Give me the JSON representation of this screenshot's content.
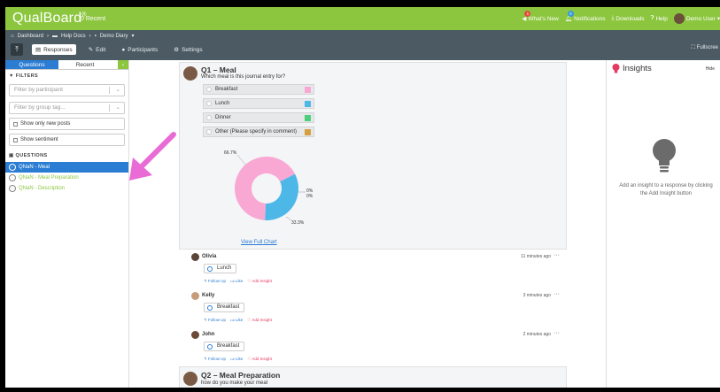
{
  "topbar": {
    "logo": "QualBoard",
    "logo_mark": "®",
    "recent": "Recent",
    "whats_new": "What's New",
    "whats_new_badge": "1",
    "notifications": "Notifications",
    "notifications_badge": "0",
    "downloads": "Downloads",
    "help": "Help",
    "user": "Demo User"
  },
  "breadcrumb": {
    "items": [
      "Dashboard",
      "Help Docs",
      "Demo Diary"
    ]
  },
  "toolbar": {
    "responses": "Responses",
    "edit": "Edit",
    "participants": "Participants",
    "settings": "Settings",
    "fullscreen": "Fullscree"
  },
  "sidebar": {
    "tab_questions": "Questions",
    "tab_recent": "Recent",
    "filters_heading": "FILTERS",
    "filter_participant_placeholder": "Filter by participant",
    "filter_group_placeholder": "Filter by group tag...",
    "show_new": "Show only new posts",
    "show_sentiment": "Show sentiment",
    "questions_heading": "QUESTIONS",
    "questions": [
      {
        "label": "QNaN - Meal",
        "active": true
      },
      {
        "label": "QNaN - Meal Preparation",
        "active": false
      },
      {
        "label": "QNaN - Description",
        "active": false
      }
    ]
  },
  "q1": {
    "title": "Q1 – Meal",
    "subtitle": "Which meal is this journal entry for?",
    "options": [
      {
        "label": "Breakfast",
        "color": "#f9a8d4"
      },
      {
        "label": "Lunch",
        "color": "#4db8e8"
      },
      {
        "label": "Dinner",
        "color": "#4ccf7a"
      },
      {
        "label": "Other (Please specify in comment)",
        "color": "#d4a040"
      }
    ],
    "view_full_chart": "View Full Chart"
  },
  "chart_data": {
    "type": "pie",
    "categories": [
      "Breakfast",
      "Lunch",
      "Dinner",
      "Other (Please specify in comment)"
    ],
    "values": [
      66.7,
      33.3,
      0,
      0
    ],
    "labels": [
      "66.7%",
      "33.3%",
      "0%",
      "0%"
    ],
    "colors": [
      "#f9a8d4",
      "#4db8e8",
      "#4ccf7a",
      "#d4a040"
    ],
    "donut": true
  },
  "responses": [
    {
      "name": "Olivia",
      "time": "11 minutes ago",
      "answer": "Lunch",
      "avatar_color": "#5a4638"
    },
    {
      "name": "Kelly",
      "time": "3 minutes ago",
      "answer": "Breakfast",
      "avatar_color": "#c99a7c"
    },
    {
      "name": "John",
      "time": "2 minutes ago",
      "answer": "Breakfast",
      "avatar_color": "#6c4a38"
    }
  ],
  "actions": {
    "follow_up": "Follow Up",
    "like": "Like",
    "add_insight": "Add Insight",
    "menu": "···"
  },
  "q2": {
    "title": "Q2 – Meal Preparation",
    "subtitle": "how do you make your meal"
  },
  "insights": {
    "title": "Insights",
    "hide": "Hide",
    "message": "Add an insight to a response by clicking the Add Insight button"
  },
  "colors": {
    "brand_green": "#8cc63f",
    "toolbar_dark": "#4c5a63",
    "accent_blue": "#2b7cd3",
    "arrow_pink": "#e86bd6"
  }
}
